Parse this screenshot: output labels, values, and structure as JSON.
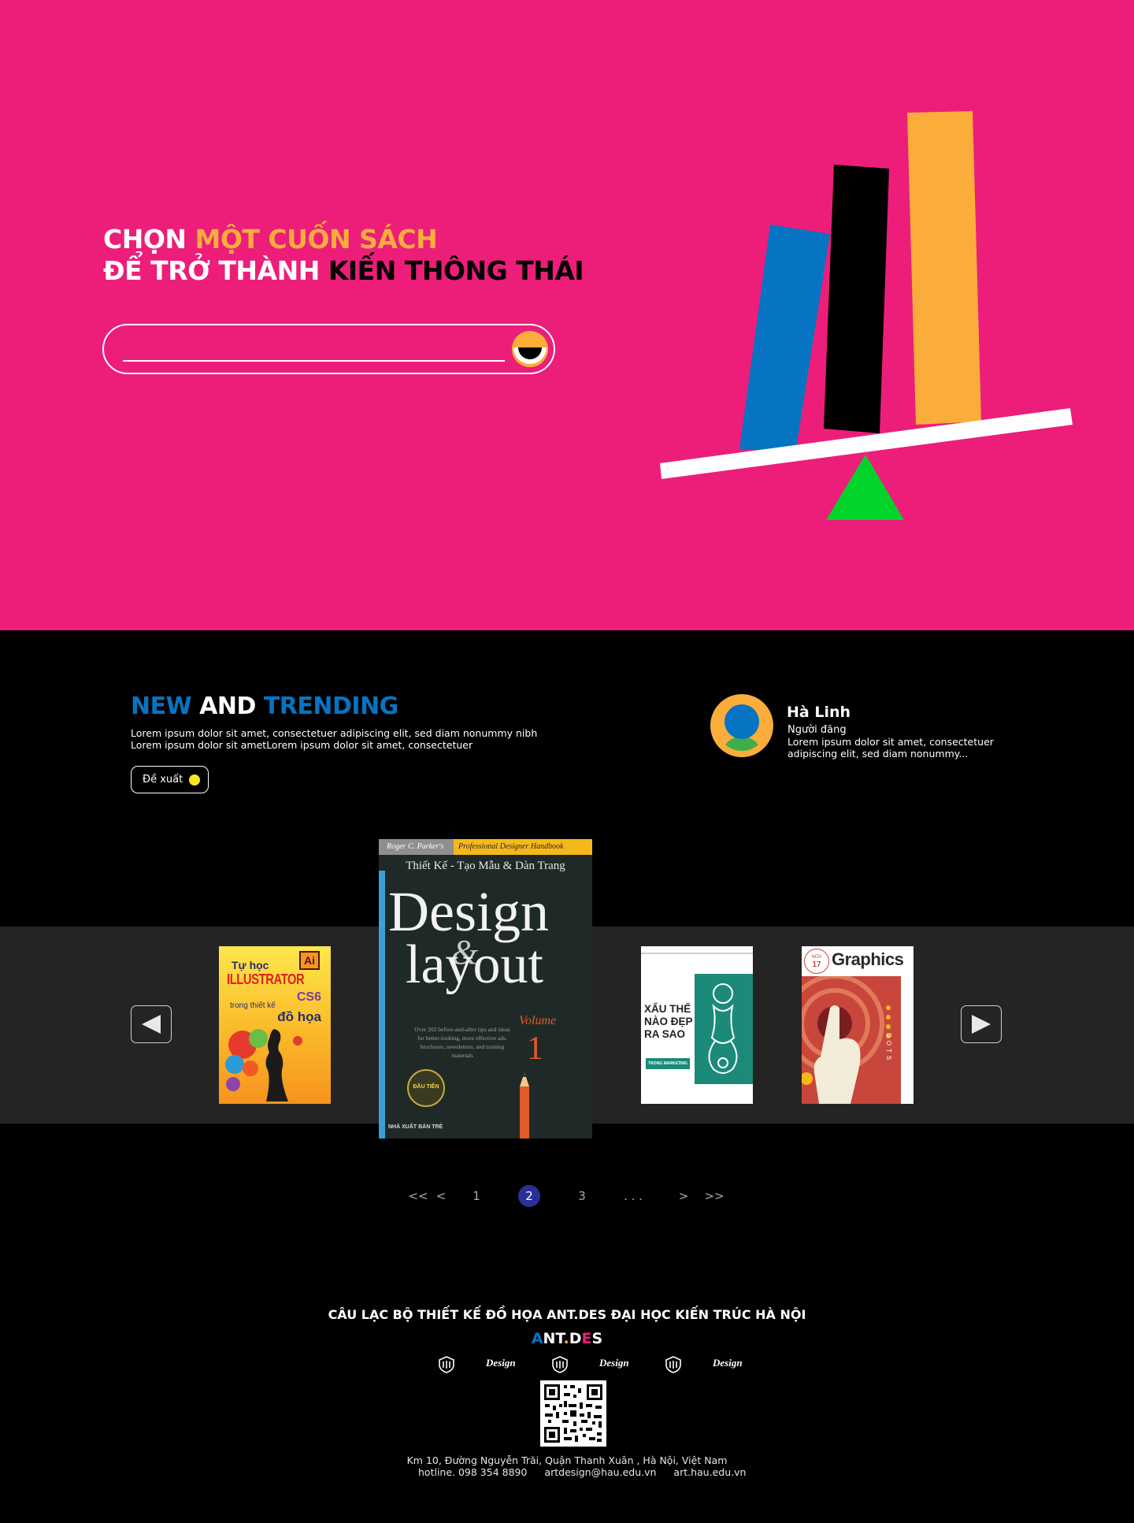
{
  "hero": {
    "title_line1_a": "CHỌN",
    "title_line1_b": "MỘT CUỐN SÁCH",
    "title_line2_a": "ĐỂ TRỞ THÀNH",
    "title_line2_b": "KIẾN THÔNG THÁI",
    "search_value": "",
    "colors": {
      "background": "#ec1e7a",
      "accent_yellow": "#fbad3b",
      "book_blue": "#0674c2",
      "fulcrum_green": "#00d42a"
    }
  },
  "trending": {
    "title_a": "NEW",
    "title_b": "AND",
    "title_c": "TRENDING",
    "desc_line1": "Lorem ipsum dolor sit amet, consectetuer adipiscing elit, sed diam nonummy nibh",
    "desc_line2": "Lorem ipsum dolor sit ametLorem ipsum dolor sit amet, consectetuer",
    "suggest_label": "Đề xuất"
  },
  "poster": {
    "name": "Hà Linh",
    "role": "Người đăng",
    "desc": "Lorem ipsum dolor sit amet, consectetuer adipiscing elit, sed diam nonummy..."
  },
  "books": [
    {
      "id": "illustrator",
      "icon": "Ai",
      "title_line1": "Tự học",
      "title_line2": "ILLUSTRATOR",
      "version": "CS6",
      "line3": "trong thiết kế",
      "line4": "đồ họa"
    },
    {
      "id": "design-layout",
      "author": "Roger C. Parker's",
      "series": "Professional Designer Handbook",
      "subtitle": "Thiết Kế - Tạo Mẫu & Dàn Trang",
      "title_a": "Design",
      "title_amp": "&",
      "title_b": "layout",
      "volume_label": "Volume",
      "volume_number": "1",
      "blurb": "Over 202 before-and-after tips and ideas for better-looking, more effective ads, brochures, newsletters, and training materials",
      "badge": "ĐẦU TIÊN",
      "publisher": "NHÀ XUẤT BẢN TRẺ"
    },
    {
      "id": "xau-the-nao",
      "title": "XẤU THẾ NÀO ĐẸP RA SAO",
      "tag": "TRONG MARKETING"
    },
    {
      "id": "graphics",
      "issue_label": "NOV",
      "issue_number": "17",
      "title": "Graphics",
      "side_text": "DOTS"
    }
  ],
  "pagination": {
    "first": "<<",
    "prev": "<",
    "pages": [
      "1",
      "2",
      "3"
    ],
    "active": "2",
    "ellipsis": ". . .",
    "next": ">",
    "last": ">>"
  },
  "footer": {
    "title": "CÂU LẠC BỘ THIẾT KẾ ĐỒ HỌA ANT.DES ĐẠI HỌC KIẾN TRÚC HÀ NỘI",
    "logo_a": "A",
    "logo_b": "NT",
    "logo_c": ".",
    "logo_d": "D",
    "logo_e": "E",
    "logo_f": "S",
    "partner_design_label": "Design",
    "address": "Km 10, Đường Nguyễn Trãi, Quận Thanh Xuân , Hà Nội, Việt Nam",
    "hotline": "hotline. 098 354 8890",
    "email": "artdesign@hau.edu.vn",
    "website": "art.hau.edu.vn"
  }
}
